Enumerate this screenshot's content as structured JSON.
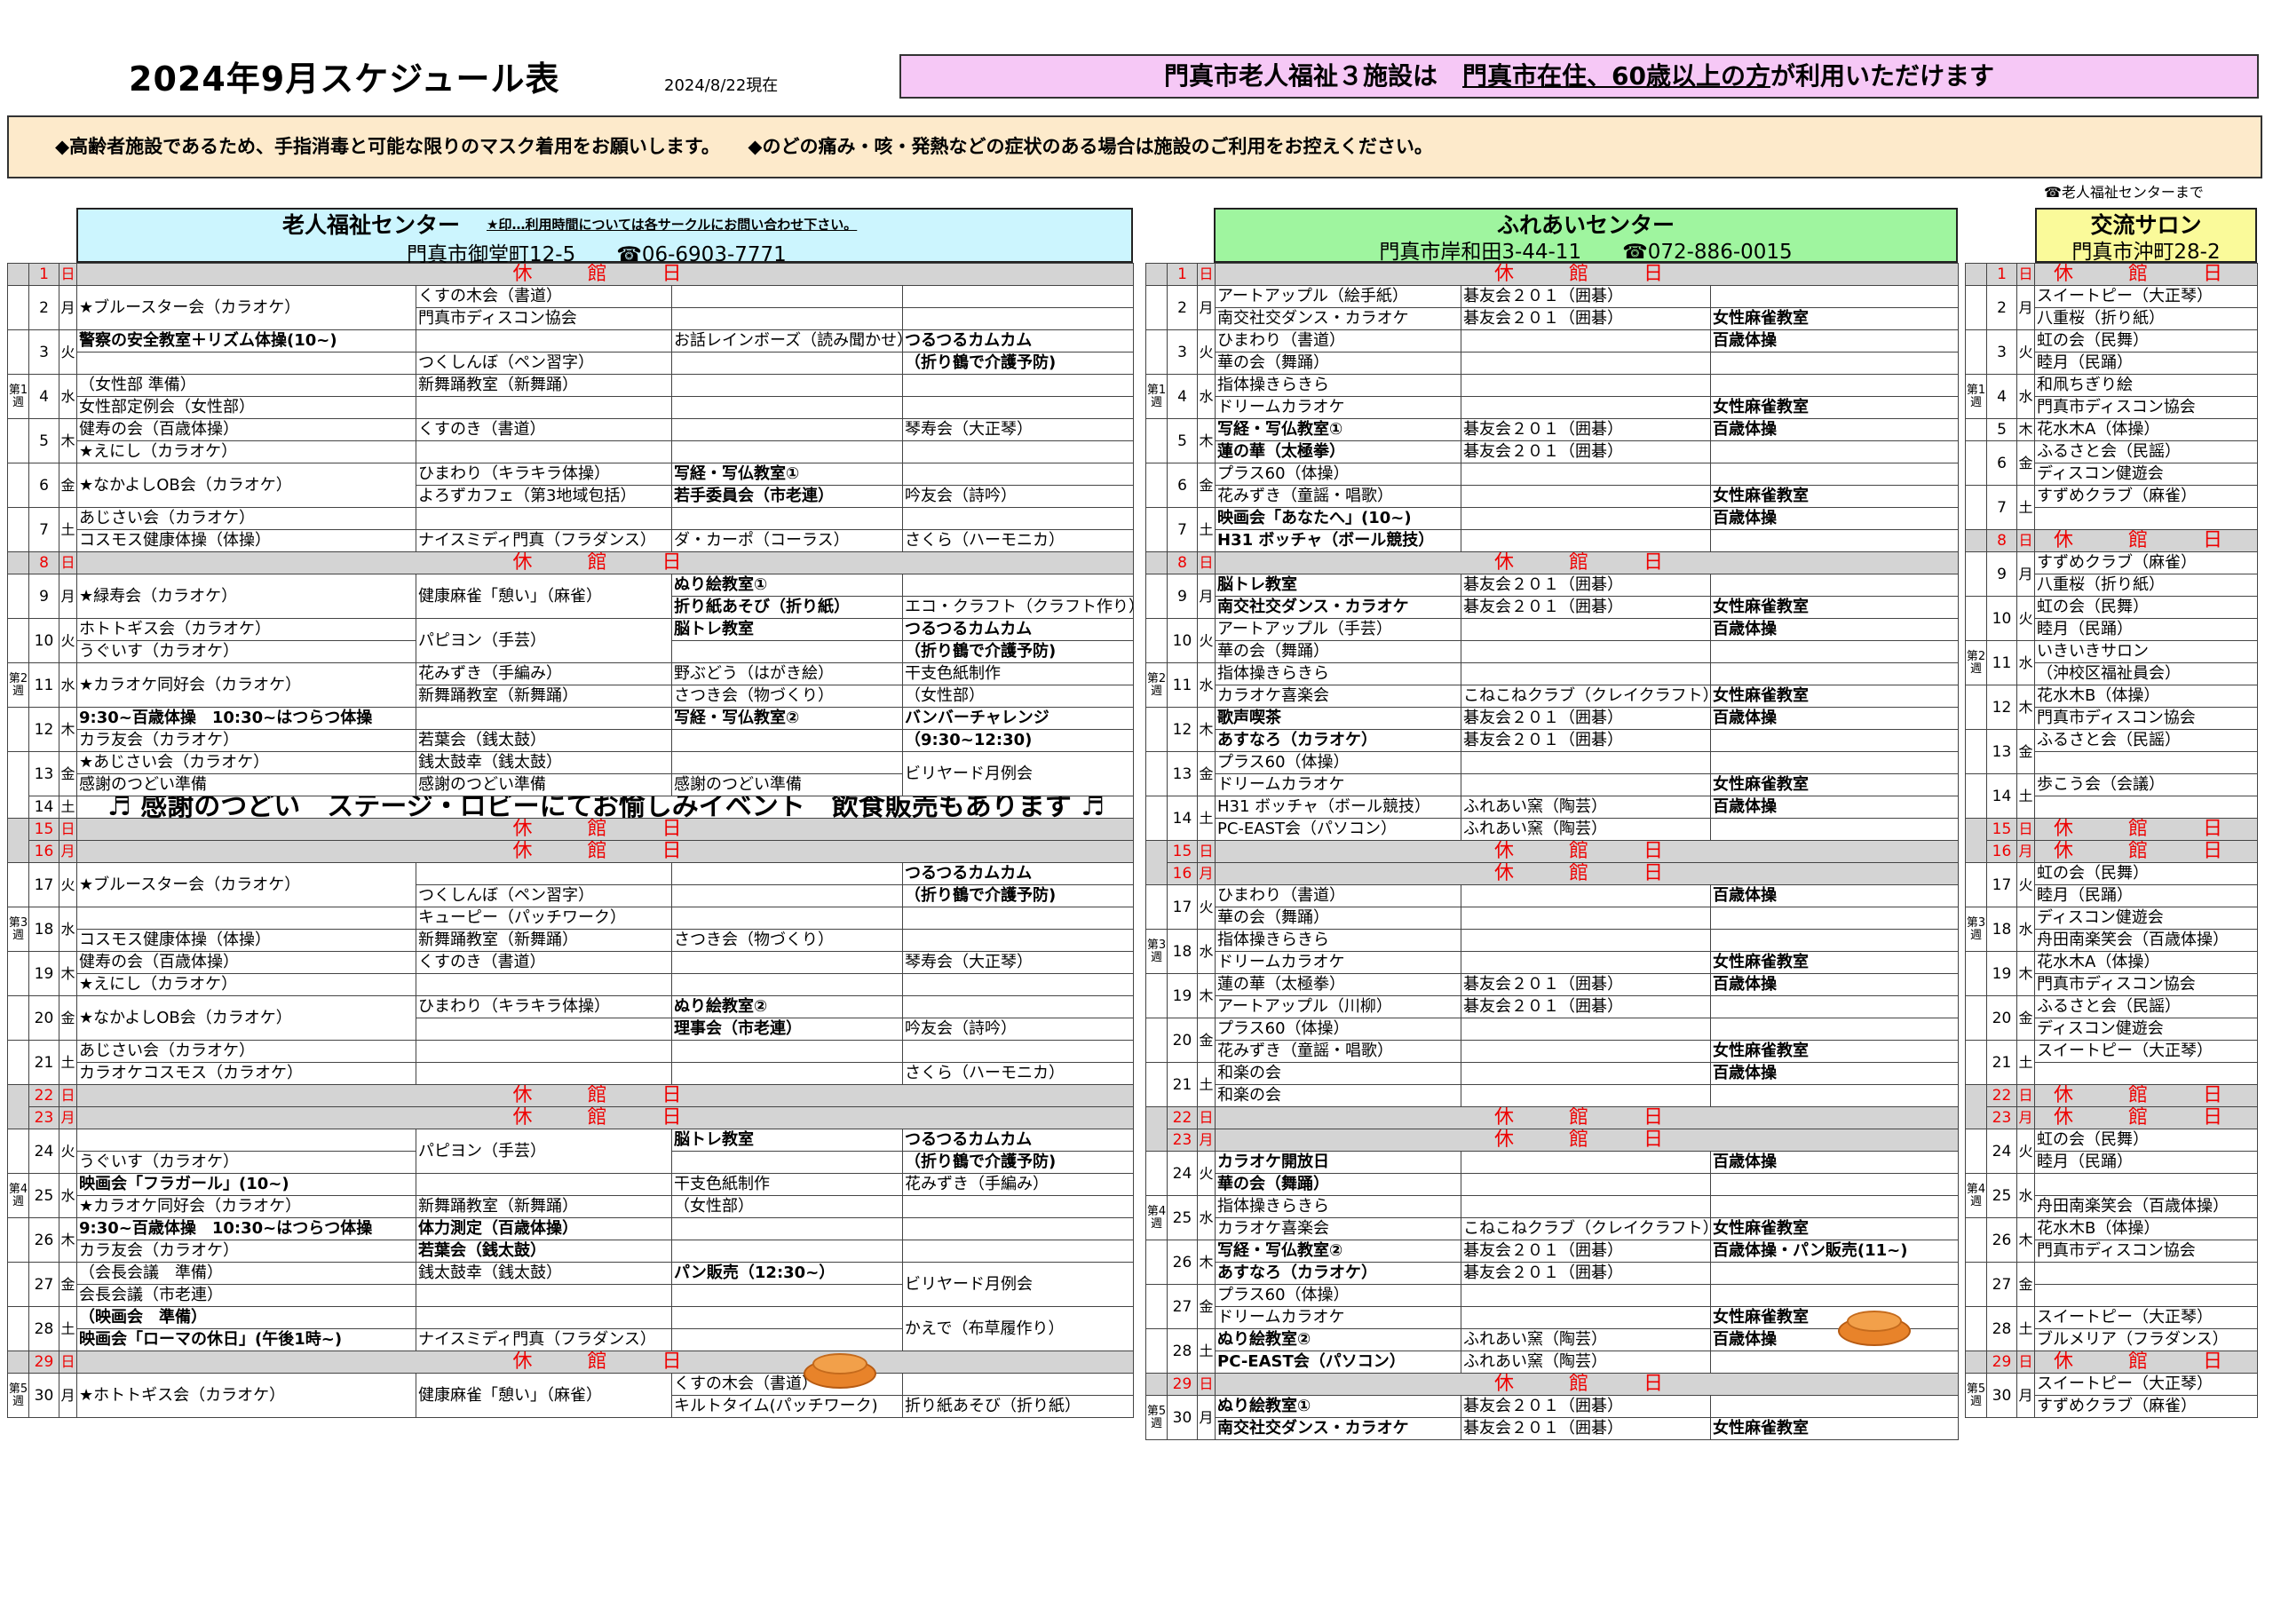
{
  "header": {
    "title": "2024年9月スケジュール表",
    "asof": "2024/8/22現在",
    "banner_pre": "門真市老人福祉３施設は　",
    "banner_u": "門真市在住、60歳以上の方",
    "banner_post": "が利用いただけます",
    "notice": "◆高齢者施設であるため、手指消毒と可能な限りのマスク着用をお願いします。　　◆のどの痛み・咳・発熱などの症状のある場合は施設のご利用をお控えください。",
    "contact": "☎老人福祉センターまで"
  },
  "facilities": {
    "a": {
      "name": "老人福祉センター",
      "address": "門真市御堂町12-5　　☎06-6903-7771",
      "note": "★印…利用時間については各サークルにお問い合わせ下さい。"
    },
    "b": {
      "name": "ふれあいセンター",
      "address": "門真市岸和田3-44-11　　☎072-886-0015"
    },
    "c": {
      "name": "交流サロン",
      "address": "門真市沖町28-2"
    }
  },
  "closed_label": "休　館　日",
  "week_labels": [
    "第1週",
    "第2週",
    "第3週",
    "第4週",
    "第5週"
  ],
  "center_a": [
    {
      "d": "1",
      "w": "日",
      "closed": true
    },
    {
      "d": "2",
      "w": "月",
      "rows": [
        [
          "★ブルースター会（カラオケ）",
          "くすの木会（書道）",
          "",
          ""
        ],
        [
          "",
          "門真市ディスコン協会",
          "",
          ""
        ]
      ],
      "merge": [
        0
      ]
    },
    {
      "d": "3",
      "w": "火",
      "rows": [
        [
          "警察の安全教室＋リズム体操(10~)",
          "",
          "お話レインボーズ（読み聞かせ）",
          "つるつるカムカム"
        ],
        [
          "",
          "つくしんぼ（ペン習字）",
          "",
          "（折り鶴で介護予防)"
        ]
      ],
      "bold": [
        0,
        3
      ]
    },
    {
      "d": "4",
      "w": "水",
      "rows": [
        [
          "（女性部 準備）",
          "新舞踊教室（新舞踊）",
          "",
          ""
        ],
        [
          "女性部定例会（女性部）",
          "",
          "",
          ""
        ]
      ]
    },
    {
      "d": "5",
      "w": "木",
      "rows": [
        [
          "健寿の会（百歳体操）",
          "くすのき（書道）",
          "",
          "琴寿会（大正琴）"
        ],
        [
          "★えにし（カラオケ）",
          "",
          "",
          ""
        ]
      ]
    },
    {
      "d": "6",
      "w": "金",
      "rows": [
        [
          "★なかよしOB会（カラオケ）",
          "ひまわり（キラキラ体操）",
          "写経・写仏教室①",
          ""
        ],
        [
          "",
          "よろずカフェ（第3地域包括）",
          "若手委員会（市老連）",
          "吟友会（詩吟）"
        ]
      ],
      "merge": [
        0
      ],
      "bold": [
        2
      ]
    },
    {
      "d": "7",
      "w": "土",
      "rows": [
        [
          "あじさい会（カラオケ）",
          "",
          "",
          ""
        ],
        [
          "コスモス健康体操（体操）",
          "ナイスミディ門真（フラダンス）",
          "ダ・カーポ（コーラス）",
          "さくら（ハーモニカ）"
        ]
      ]
    },
    {
      "d": "8",
      "w": "日",
      "closed": true
    },
    {
      "d": "9",
      "w": "月",
      "rows": [
        [
          "★緑寿会（カラオケ）",
          "健康麻雀「憩い」（麻雀）",
          "ぬり絵教室①",
          ""
        ],
        [
          "",
          "",
          "折り紙あそび（折り紙）",
          "エコ・クラフト（クラフト作り）"
        ]
      ],
      "merge": [
        0,
        1
      ],
      "bold": [
        2
      ]
    },
    {
      "d": "10",
      "w": "火",
      "rows": [
        [
          "ホトトギス会（カラオケ）",
          "パピヨン（手芸）",
          "脳トレ教室",
          "つるつるカムカム"
        ],
        [
          "うぐいす（カラオケ）",
          "",
          "",
          "（折り鶴で介護予防)"
        ]
      ],
      "merge": [
        1
      ],
      "bold": [
        2,
        3
      ]
    },
    {
      "d": "11",
      "w": "水",
      "rows": [
        [
          "★カラオケ同好会（カラオケ）",
          "花みずき（手編み）",
          "野ぶどう（はがき絵）",
          "干支色紙制作"
        ],
        [
          "",
          "新舞踊教室（新舞踊）",
          "さつき会（物づくり）",
          "（女性部）"
        ]
      ],
      "merge": [
        0
      ]
    },
    {
      "d": "12",
      "w": "木",
      "rows": [
        [
          "9:30~百歳体操　10:30~はつらつ体操",
          "",
          "写経・写仏教室②",
          "バンバーチャレンジ"
        ],
        [
          "カラ友会（カラオケ）",
          "若葉会（銭太鼓）",
          "",
          "（9:30~12:30)"
        ]
      ],
      "bold": [
        0,
        2,
        3
      ]
    },
    {
      "d": "13",
      "w": "金",
      "rows": [
        [
          "★あじさい会（カラオケ）",
          "銭太鼓幸（銭太鼓）",
          "",
          "ビリヤード月例会"
        ],
        [
          "感謝のつどい準備",
          "感謝のつどい準備",
          "感謝のつどい準備",
          ""
        ]
      ],
      "merge": [
        3
      ]
    },
    {
      "d": "14",
      "w": "土",
      "event": "♬ 感謝のつどい　ステージ・ロビーにてお愉しみイベント　飲食販売もあります ♬"
    },
    {
      "d": "15",
      "w": "日",
      "closed": true
    },
    {
      "d": "16",
      "w": "月",
      "closed": true
    },
    {
      "d": "17",
      "w": "火",
      "rows": [
        [
          "★ブルースター会（カラオケ）",
          "",
          "",
          "つるつるカムカム"
        ],
        [
          "",
          "つくしんぼ（ペン習字）",
          "",
          "（折り鶴で介護予防)"
        ]
      ],
      "merge": [
        0
      ],
      "bold": [
        3
      ]
    },
    {
      "d": "18",
      "w": "水",
      "rows": [
        [
          "",
          "キューピー（パッチワーク）",
          "",
          ""
        ],
        [
          "コスモス健康体操（体操）",
          "新舞踊教室（新舞踊）",
          "さつき会（物づくり）",
          ""
        ]
      ]
    },
    {
      "d": "19",
      "w": "木",
      "rows": [
        [
          "健寿の会（百歳体操）",
          "くすのき（書道）",
          "",
          "琴寿会（大正琴）"
        ],
        [
          "★えにし（カラオケ）",
          "",
          "",
          ""
        ]
      ]
    },
    {
      "d": "20",
      "w": "金",
      "rows": [
        [
          "★なかよしOB会（カラオケ）",
          "ひまわり（キラキラ体操）",
          "ぬり絵教室②",
          ""
        ],
        [
          "",
          "",
          "理事会（市老連）",
          "吟友会（詩吟）"
        ]
      ],
      "merge": [
        0
      ],
      "bold": [
        2
      ]
    },
    {
      "d": "21",
      "w": "土",
      "rows": [
        [
          "あじさい会（カラオケ）",
          "",
          "",
          ""
        ],
        [
          "カラオケコスモス（カラオケ）",
          "",
          "",
          "さくら（ハーモニカ）"
        ]
      ]
    },
    {
      "d": "22",
      "w": "日",
      "closed": true
    },
    {
      "d": "23",
      "w": "月",
      "closed": true
    },
    {
      "d": "24",
      "w": "火",
      "rows": [
        [
          "",
          "パピヨン（手芸）",
          "脳トレ教室",
          "つるつるカムカム"
        ],
        [
          "うぐいす（カラオケ）",
          "",
          "",
          "（折り鶴で介護予防)"
        ]
      ],
      "merge": [
        1
      ],
      "bold": [
        2,
        3
      ]
    },
    {
      "d": "25",
      "w": "水",
      "rows": [
        [
          "映画会「フラガール」(10~)",
          "",
          "干支色紙制作",
          "花みずき（手編み）"
        ],
        [
          "★カラオケ同好会（カラオケ）",
          "新舞踊教室（新舞踊）",
          "（女性部）",
          ""
        ]
      ],
      "bold": [
        0
      ]
    },
    {
      "d": "26",
      "w": "木",
      "rows": [
        [
          "9:30~百歳体操　10:30~はつらつ体操",
          "体力測定（百歳体操）",
          "",
          ""
        ],
        [
          "カラ友会（カラオケ）",
          "若葉会（銭太鼓）",
          "",
          ""
        ]
      ],
      "bold": [
        0,
        1
      ]
    },
    {
      "d": "27",
      "w": "金",
      "rows": [
        [
          "（会長会議　準備）",
          "銭太鼓幸（銭太鼓）",
          "パン販売（12:30~）",
          "ビリヤード月例会"
        ],
        [
          "会長会議（市老連）",
          "",
          "",
          ""
        ]
      ],
      "merge": [
        3
      ],
      "bold": [
        2
      ]
    },
    {
      "d": "28",
      "w": "土",
      "rows": [
        [
          "（映画会　準備）",
          "",
          "",
          "かえで（布草履作り）"
        ],
        [
          "映画会「ローマの休日」(午後1時~)",
          "ナイスミディ門真（フラダンス）",
          "",
          ""
        ]
      ],
      "merge": [
        3
      ],
      "bold": [
        0
      ]
    },
    {
      "d": "29",
      "w": "日",
      "closed": true
    },
    {
      "d": "30",
      "w": "月",
      "rows": [
        [
          "★ホトトギス会（カラオケ）",
          "健康麻雀「憩い」（麻雀）",
          "くすの木会（書道）",
          ""
        ],
        [
          "",
          "",
          "キルトタイム(パッチワーク)",
          "折り紙あそび（折り紙）"
        ]
      ],
      "merge": [
        0,
        1
      ]
    }
  ],
  "center_b": [
    {
      "d": "1",
      "w": "日",
      "closed": true
    },
    {
      "d": "2",
      "w": "月",
      "rows": [
        [
          "アートアップル（絵手紙）",
          "碁友会２０１（囲碁）",
          ""
        ],
        [
          "南交社交ダンス・カラオケ",
          "碁友会２０１（囲碁）",
          "女性麻雀教室"
        ]
      ],
      "bold": [
        2
      ]
    },
    {
      "d": "3",
      "w": "火",
      "rows": [
        [
          "ひまわり（書道）",
          "",
          "百歳体操"
        ],
        [
          "華の会（舞踊）",
          "",
          ""
        ]
      ],
      "bold": [
        2
      ]
    },
    {
      "d": "4",
      "w": "水",
      "rows": [
        [
          "指体操きらきら",
          "",
          ""
        ],
        [
          "ドリームカラオケ",
          "",
          "女性麻雀教室"
        ]
      ],
      "bold": [
        2
      ]
    },
    {
      "d": "5",
      "w": "木",
      "rows": [
        [
          "写経・写仏教室①",
          "碁友会２０１（囲碁）",
          "百歳体操"
        ],
        [
          "蓮の華（太極拳）",
          "碁友会２０１（囲碁）",
          ""
        ]
      ],
      "bold": [
        0,
        2
      ]
    },
    {
      "d": "6",
      "w": "金",
      "rows": [
        [
          "プラス60（体操）",
          "",
          ""
        ],
        [
          "花みずき（童謡・唱歌）",
          "",
          "女性麻雀教室"
        ]
      ],
      "bold": [
        2
      ]
    },
    {
      "d": "7",
      "w": "土",
      "rows": [
        [
          "映画会「あなたへ」(10~)",
          "",
          "百歳体操"
        ],
        [
          "H31 ボッチャ（ボール競技）",
          "",
          ""
        ]
      ],
      "bold": [
        0,
        2
      ]
    },
    {
      "d": "8",
      "w": "日",
      "closed": true
    },
    {
      "d": "9",
      "w": "月",
      "rows": [
        [
          "脳トレ教室",
          "碁友会２０１（囲碁）",
          ""
        ],
        [
          "南交社交ダンス・カラオケ",
          "碁友会２０１（囲碁）",
          "女性麻雀教室"
        ]
      ],
      "bold": [
        0,
        2
      ]
    },
    {
      "d": "10",
      "w": "火",
      "rows": [
        [
          "アートアップル（手芸）",
          "",
          "百歳体操"
        ],
        [
          "華の会（舞踊）",
          "",
          ""
        ]
      ],
      "bold": [
        2
      ]
    },
    {
      "d": "11",
      "w": "水",
      "rows": [
        [
          "指体操きらきら",
          "",
          ""
        ],
        [
          "カラオケ喜楽会",
          "こねこねクラブ（クレイクラフト）",
          "女性麻雀教室"
        ]
      ],
      "bold": [
        2
      ]
    },
    {
      "d": "12",
      "w": "木",
      "rows": [
        [
          "歌声喫茶",
          "碁友会２０１（囲碁）",
          "百歳体操"
        ],
        [
          "あすなろ（カラオケ）",
          "碁友会２０１（囲碁）",
          ""
        ]
      ],
      "bold": [
        0,
        2
      ]
    },
    {
      "d": "13",
      "w": "金",
      "rows": [
        [
          "プラス60（体操）",
          "",
          ""
        ],
        [
          "ドリームカラオケ",
          "",
          "女性麻雀教室"
        ]
      ],
      "bold": [
        2
      ]
    },
    {
      "d": "14",
      "w": "土",
      "rows": [
        [
          "H31 ボッチャ（ボール競技）",
          "ふれあい窯（陶芸）",
          "百歳体操"
        ],
        [
          "PC-EAST会（パソコン）",
          "ふれあい窯（陶芸）",
          ""
        ]
      ],
      "bold": [
        2
      ]
    },
    {
      "d": "15",
      "w": "日",
      "closed": true
    },
    {
      "d": "16",
      "w": "月",
      "closed": true
    },
    {
      "d": "17",
      "w": "火",
      "rows": [
        [
          "ひまわり（書道）",
          "",
          "百歳体操"
        ],
        [
          "華の会（舞踊）",
          "",
          ""
        ]
      ],
      "bold": [
        2
      ]
    },
    {
      "d": "18",
      "w": "水",
      "rows": [
        [
          "指体操きらきら",
          "",
          ""
        ],
        [
          "ドリームカラオケ",
          "",
          "女性麻雀教室"
        ]
      ],
      "bold": [
        2
      ]
    },
    {
      "d": "19",
      "w": "木",
      "rows": [
        [
          "蓮の華（太極拳）",
          "碁友会２０１（囲碁）",
          "百歳体操"
        ],
        [
          "アートアップル（川柳）",
          "碁友会２０１（囲碁）",
          ""
        ]
      ],
      "bold": [
        2
      ]
    },
    {
      "d": "20",
      "w": "金",
      "rows": [
        [
          "プラス60（体操）",
          "",
          ""
        ],
        [
          "花みずき（童謡・唱歌）",
          "",
          "女性麻雀教室"
        ]
      ],
      "bold": [
        2
      ]
    },
    {
      "d": "21",
      "w": "土",
      "rows": [
        [
          "和楽の会",
          "",
          "百歳体操"
        ],
        [
          "和楽の会",
          "",
          ""
        ]
      ],
      "bold": [
        2
      ]
    },
    {
      "d": "22",
      "w": "日",
      "closed": true
    },
    {
      "d": "23",
      "w": "月",
      "closed": true
    },
    {
      "d": "24",
      "w": "火",
      "rows": [
        [
          "カラオケ開放日",
          "",
          "百歳体操"
        ],
        [
          "華の会（舞踊）",
          "",
          ""
        ]
      ],
      "bold": [
        0,
        2
      ]
    },
    {
      "d": "25",
      "w": "水",
      "rows": [
        [
          "指体操きらきら",
          "",
          ""
        ],
        [
          "カラオケ喜楽会",
          "こねこねクラブ（クレイクラフト）",
          "女性麻雀教室"
        ]
      ],
      "bold": [
        2
      ]
    },
    {
      "d": "26",
      "w": "木",
      "rows": [
        [
          "写経・写仏教室②",
          "碁友会２０１（囲碁）",
          "百歳体操・パン販売(11~)"
        ],
        [
          "あすなろ（カラオケ）",
          "碁友会２０１（囲碁）",
          ""
        ]
      ],
      "bold": [
        0,
        2
      ]
    },
    {
      "d": "27",
      "w": "金",
      "rows": [
        [
          "プラス60（体操）",
          "",
          ""
        ],
        [
          "ドリームカラオケ",
          "",
          "女性麻雀教室"
        ]
      ],
      "bold": [
        2
      ]
    },
    {
      "d": "28",
      "w": "土",
      "rows": [
        [
          "ぬり絵教室②",
          "ふれあい窯（陶芸）",
          "百歳体操"
        ],
        [
          "PC-EAST会（パソコン）",
          "ふれあい窯（陶芸）",
          ""
        ]
      ],
      "bold": [
        0,
        2
      ]
    },
    {
      "d": "29",
      "w": "日",
      "closed": true
    },
    {
      "d": "30",
      "w": "月",
      "rows": [
        [
          "ぬり絵教室①",
          "碁友会２０１（囲碁）",
          ""
        ],
        [
          "南交社交ダンス・カラオケ",
          "碁友会２０１（囲碁）",
          "女性麻雀教室"
        ]
      ],
      "bold": [
        0,
        2
      ]
    }
  ],
  "center_c": [
    {
      "d": "1",
      "w": "日",
      "closed": true
    },
    {
      "d": "2",
      "w": "月",
      "rows": [
        "スイートピー（大正琴）",
        "八重桜（折り紙）"
      ]
    },
    {
      "d": "3",
      "w": "火",
      "rows": [
        "虹の会（民舞）",
        "睦月（民踊）"
      ]
    },
    {
      "d": "4",
      "w": "水",
      "rows": [
        "和凧ちぎり絵",
        "門真市ディスコン協会"
      ]
    },
    {
      "d": "5",
      "w": "木",
      "rows": [
        "花水木A（体操）",
        ""
      ],
      "merge": true
    },
    {
      "d": "6",
      "w": "金",
      "rows": [
        "ふるさと会（民謡）",
        "ディスコン健遊会"
      ]
    },
    {
      "d": "7",
      "w": "土",
      "rows": [
        "すずめクラブ（麻雀）",
        ""
      ]
    },
    {
      "d": "8",
      "w": "日",
      "closed": true
    },
    {
      "d": "9",
      "w": "月",
      "rows": [
        "すずめクラブ（麻雀）",
        "八重桜（折り紙）"
      ]
    },
    {
      "d": "10",
      "w": "火",
      "rows": [
        "虹の会（民舞）",
        "睦月（民踊）"
      ]
    },
    {
      "d": "11",
      "w": "水",
      "rows": [
        "いきいきサロン",
        "（沖校区福祉員会）"
      ]
    },
    {
      "d": "12",
      "w": "木",
      "rows": [
        "花水木B（体操）",
        "門真市ディスコン協会"
      ]
    },
    {
      "d": "13",
      "w": "金",
      "rows": [
        "ふるさと会（民謡）",
        ""
      ]
    },
    {
      "d": "14",
      "w": "土",
      "rows": [
        "歩こう会（会議）",
        ""
      ]
    },
    {
      "d": "15",
      "w": "日",
      "closed": true
    },
    {
      "d": "16",
      "w": "月",
      "closed": true
    },
    {
      "d": "17",
      "w": "火",
      "rows": [
        "虹の会（民舞）",
        "睦月（民踊）"
      ]
    },
    {
      "d": "18",
      "w": "水",
      "rows": [
        "ディスコン健遊会",
        "舟田南楽笑会（百歳体操）"
      ]
    },
    {
      "d": "19",
      "w": "木",
      "rows": [
        "花水木A（体操）",
        "門真市ディスコン協会"
      ]
    },
    {
      "d": "20",
      "w": "金",
      "rows": [
        "ふるさと会（民謡）",
        "ディスコン健遊会"
      ]
    },
    {
      "d": "21",
      "w": "土",
      "rows": [
        "スイートピー（大正琴）",
        ""
      ]
    },
    {
      "d": "22",
      "w": "日",
      "closed": true
    },
    {
      "d": "23",
      "w": "月",
      "closed": true
    },
    {
      "d": "24",
      "w": "火",
      "rows": [
        "虹の会（民舞）",
        "睦月（民踊）"
      ]
    },
    {
      "d": "25",
      "w": "水",
      "rows": [
        "",
        "舟田南楽笑会（百歳体操）"
      ]
    },
    {
      "d": "26",
      "w": "木",
      "rows": [
        "花水木B（体操）",
        "門真市ディスコン協会"
      ]
    },
    {
      "d": "27",
      "w": "金",
      "rows": [
        "",
        ""
      ]
    },
    {
      "d": "28",
      "w": "土",
      "rows": [
        "スイートピー（大正琴）",
        "ブルメリア（フラダンス）"
      ]
    },
    {
      "d": "29",
      "w": "日",
      "closed": true
    },
    {
      "d": "30",
      "w": "月",
      "rows": [
        "スイートピー（大正琴）",
        "すずめクラブ（麻雀）"
      ]
    }
  ],
  "icons": {
    "pie_a": "pie-icon",
    "pie_b": "pie-icon"
  }
}
